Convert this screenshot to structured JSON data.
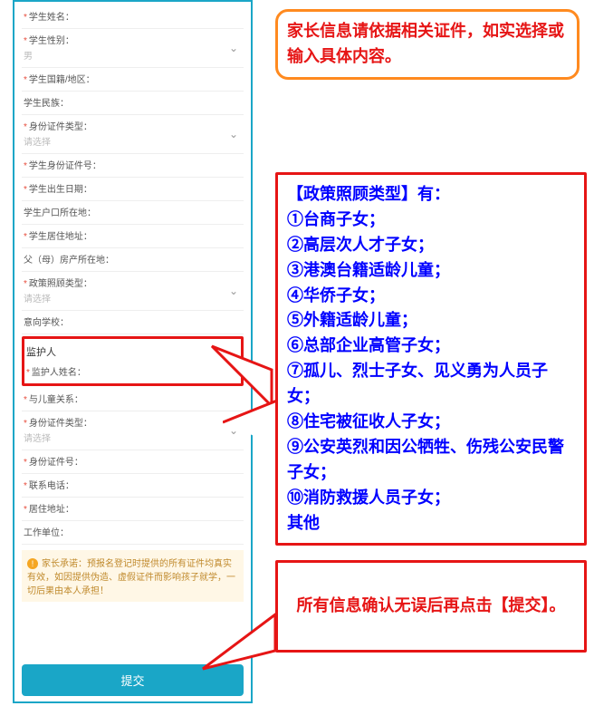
{
  "form": {
    "fields": [
      {
        "label": "学生姓名：",
        "required": true
      },
      {
        "label": "学生性别：",
        "required": true,
        "value": "男",
        "select": true
      },
      {
        "label": "学生国籍/地区：",
        "required": true
      },
      {
        "label": "学生民族：",
        "required": false
      },
      {
        "label": "身份证件类型：",
        "required": true,
        "value": "请选择",
        "select": true
      },
      {
        "label": "学生身份证件号：",
        "required": true
      },
      {
        "label": "学生出生日期：",
        "required": true
      },
      {
        "label": "学生户口所在地：",
        "required": false
      },
      {
        "label": "学生居住地址：",
        "required": true
      },
      {
        "label": "父（母）房产所在地：",
        "required": false
      },
      {
        "label": "政策照顾类型：",
        "required": true,
        "value": "请选择",
        "select": true
      },
      {
        "label": "意向学校：",
        "required": false
      }
    ],
    "guardian_section": "监护人",
    "guardian_name_label": "监护人姓名：",
    "guardian_fields": [
      {
        "label": "与儿童关系：",
        "required": true
      },
      {
        "label": "身份证件类型：",
        "required": true,
        "value": "请选择",
        "select": true
      },
      {
        "label": "身份证件号：",
        "required": true
      },
      {
        "label": "联系电话：",
        "required": true
      },
      {
        "label": "居住地址：",
        "required": true
      },
      {
        "label": "工作单位：",
        "required": false
      }
    ],
    "declaration": "家长承诺：预报名登记时提供的所有证件均真实有效，如因提供伪造、虚假证件而影响孩子就学，一切后果由本人承担！",
    "submit": "提交"
  },
  "callouts": {
    "orange": "家长信息请依据相关证件，如实选择或输入具体内容。",
    "policy_lines": [
      "【政策照顾类型】有：",
      "①台商子女；",
      "②高层次人才子女；",
      "③港澳台籍适龄儿童；",
      "④华侨子女；",
      "⑤外籍适龄儿童；",
      "⑥总部企业高管子女；",
      "⑦孤儿、烈士子女、见义勇为人员子女；",
      "⑧住宅被征收人子女；",
      "⑨公安英烈和因公牺牲、伤残公安民警子女；",
      "⑩消防救援人员子女；",
      "其他"
    ],
    "confirm": "所有信息确认无误后再点击【提交】。"
  }
}
